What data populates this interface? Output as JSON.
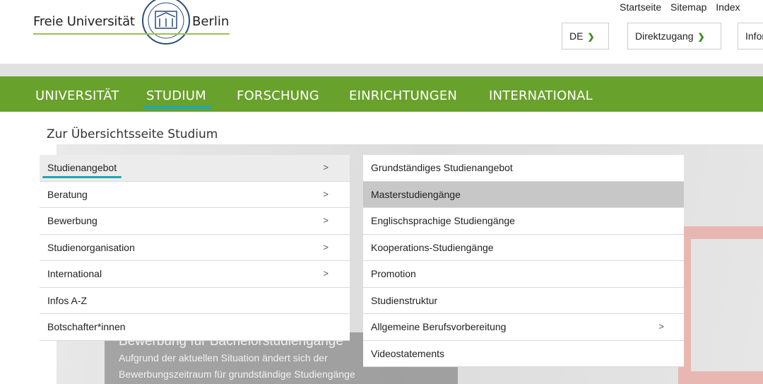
{
  "header": {
    "logo_left": "Freie Universität",
    "logo_right": "Berlin",
    "top_links": [
      "Startseite",
      "Sitemap",
      "Index"
    ],
    "lang_selector": "DE",
    "quick_access": "Direktzugang",
    "info_selector": "Infor"
  },
  "mainnav": {
    "items": [
      "UNIVERSITÄT",
      "STUDIUM",
      "FORSCHUNG",
      "EINRICHTUNGEN",
      "INTERNATIONAL"
    ],
    "active": "STUDIUM"
  },
  "content": {
    "overview_link": "Zur Übersichtsseite Studium",
    "background_title": "Bewerbung für Bachelorstudiengänge",
    "background_line1": "Aufgrund der aktuellen Situation ändert sich der",
    "background_line2": "Bewerbungszeitraum für grundständige Studiengänge"
  },
  "leftmenu": {
    "items": [
      {
        "label": "Studienangebot",
        "has_submenu": true,
        "active": true
      },
      {
        "label": "Beratung",
        "has_submenu": true
      },
      {
        "label": "Bewerbung",
        "has_submenu": true
      },
      {
        "label": "Studienorganisation",
        "has_submenu": true
      },
      {
        "label": "International",
        "has_submenu": true
      },
      {
        "label": "Infos A-Z",
        "has_submenu": false
      },
      {
        "label": "Botschafter*innen",
        "has_submenu": false
      }
    ]
  },
  "rightmenu": {
    "items": [
      {
        "label": "Grundständiges Studienangebot",
        "has_submenu": false
      },
      {
        "label": "Masterstudiengänge",
        "has_submenu": false,
        "hover": true
      },
      {
        "label": "Englischsprachige Studiengänge",
        "has_submenu": false
      },
      {
        "label": "Kooperations-Studiengänge",
        "has_submenu": false
      },
      {
        "label": "Promotion",
        "has_submenu": false
      },
      {
        "label": "Studienstruktur",
        "has_submenu": false
      },
      {
        "label": "Allgemeine Berufsvorbereitung",
        "has_submenu": true
      },
      {
        "label": "Videostatements",
        "has_submenu": false
      }
    ]
  },
  "icons": {
    "chevron": "chevron-down-icon",
    "submenu_arrow": "chevron-right-icon",
    "seal": "university-seal-icon"
  },
  "colors": {
    "nav_green": "#68a12b",
    "accent_teal": "#1ea6b5",
    "logo_line": "#99c24d",
    "chevron_green": "#3a8c1e"
  }
}
